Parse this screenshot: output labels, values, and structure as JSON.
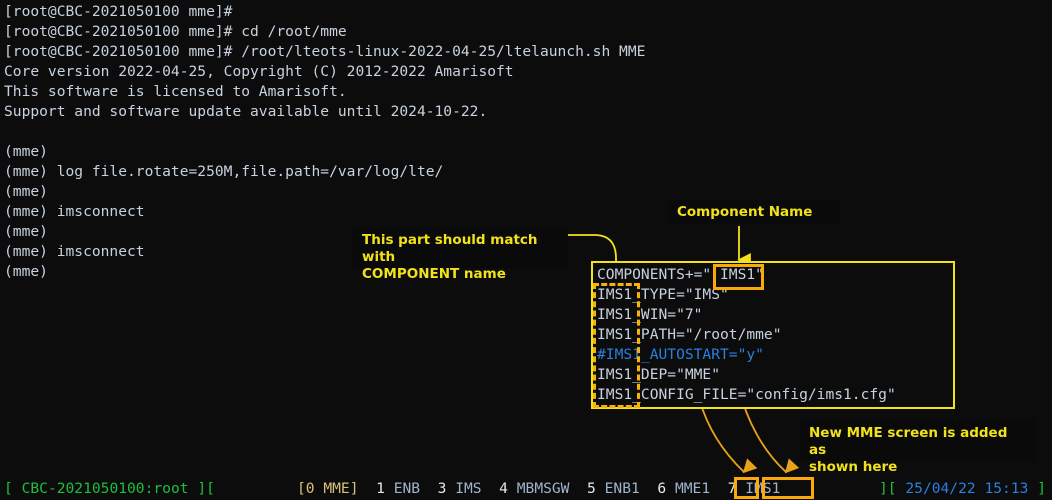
{
  "terminal": {
    "lines": [
      "[root@CBC-2021050100 mme]#",
      "[root@CBC-2021050100 mme]# cd /root/mme",
      "[root@CBC-2021050100 mme]# /root/lteots-linux-2022-04-25/ltelaunch.sh MME",
      "Core version 2022-04-25, Copyright (C) 2012-2022 Amarisoft",
      "This software is licensed to Amarisoft.",
      "Support and software update available until 2024-10-22.",
      "",
      "(mme)",
      "(mme) log file.rotate=250M,file.path=/var/log/lte/",
      "(mme)",
      "(mme) imsconnect",
      "(mme)",
      "(mme) imsconnect",
      "(mme)"
    ]
  },
  "config_block": {
    "lines": [
      {
        "text": "COMPONENTS+=\" IMS1\"",
        "comment": false
      },
      {
        "text": "IMS1_TYPE=\"IMS\"",
        "comment": false
      },
      {
        "text": "IMS1_WIN=\"7\"",
        "comment": false
      },
      {
        "text": "IMS1_PATH=\"/root/mme\"",
        "comment": false
      },
      {
        "text": "#IMS1_AUTOSTART=\"y\"",
        "comment": true
      },
      {
        "text": "IMS1_DEP=\"MME\"",
        "comment": false
      },
      {
        "text": "IMS1_CONFIG_FILE=\"config/ims1.cfg\"",
        "comment": false
      }
    ]
  },
  "annotations": {
    "match_component": "This part should match with\nCOMPONENT name",
    "component_name": "Component Name",
    "new_screen": "New MME screen is added as\nshown here"
  },
  "statusbar": {
    "left_open": "[",
    "host": " CBC-2021050100:root ",
    "left_close": "][",
    "windows": [
      {
        "num": "0",
        "name": "MME",
        "current": true
      },
      {
        "num": "1",
        "name": "ENB",
        "current": false
      },
      {
        "num": "3",
        "name": "IMS",
        "current": false
      },
      {
        "num": "4",
        "name": "MBMSGW",
        "current": false
      },
      {
        "num": "5",
        "name": "ENB1",
        "current": false
      },
      {
        "num": "6",
        "name": "MME1",
        "current": false
      },
      {
        "num": "7",
        "name": "IMS1",
        "current": false
      }
    ],
    "right_open": "][",
    "date": "25/04/22",
    "time": "15:13",
    "right_close": "]"
  },
  "colors": {
    "annotation_yellow": "#f2e21a",
    "highlight_orange": "#f9a90a",
    "terminal_fg": "#c8d2de",
    "comment_blue": "#2a7fe0",
    "host_green": "#1fbf3a",
    "background": "#0c0c0c"
  }
}
